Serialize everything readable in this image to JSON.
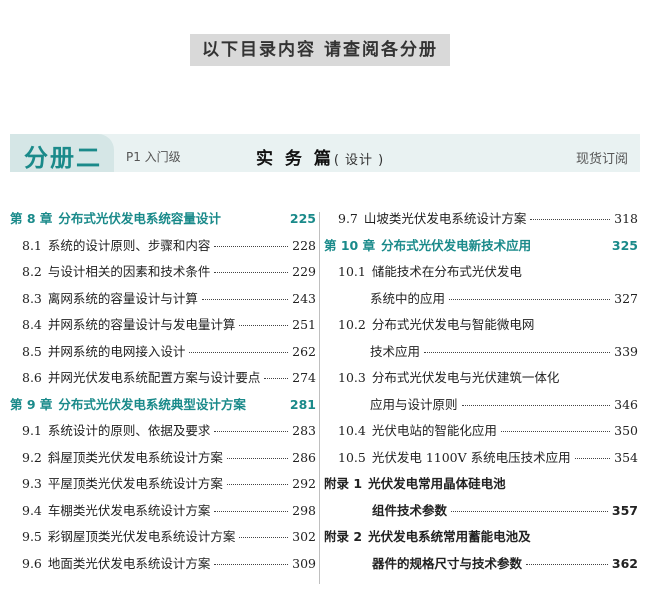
{
  "banner": "以下目录内容 请查阅各分册",
  "header": {
    "volume": "分册二",
    "level": "P1 入门级",
    "title": "实 务 篇",
    "title_sub": "( 设计 )",
    "stock": "现货订阅"
  },
  "left": [
    {
      "type": "ch",
      "num": "第 8 章",
      "text": "分布式光伏发电系统容量设计",
      "page": "225"
    },
    {
      "type": "sec",
      "num": "8.1",
      "text": "系统的设计原则、步骤和内容",
      "page": "228"
    },
    {
      "type": "sec",
      "num": "8.2",
      "text": "与设计相关的因素和技术条件",
      "page": "229"
    },
    {
      "type": "sec",
      "num": "8.3",
      "text": "离网系统的容量设计与计算",
      "page": "243"
    },
    {
      "type": "sec",
      "num": "8.4",
      "text": "并网系统的容量设计与发电量计算",
      "page": "251"
    },
    {
      "type": "sec",
      "num": "8.5",
      "text": "并网系统的电网接入设计",
      "page": "262"
    },
    {
      "type": "sec",
      "num": "8.6",
      "text": "并网光伏发电系统配置方案与设计要点",
      "page": "274"
    },
    {
      "type": "ch",
      "num": "第 9 章",
      "text": "分布式光伏发电系统典型设计方案",
      "page": "281"
    },
    {
      "type": "sec",
      "num": "9.1",
      "text": "系统设计的原则、依据及要求",
      "page": "283"
    },
    {
      "type": "sec",
      "num": "9.2",
      "text": "斜屋顶类光伏发电系统设计方案",
      "page": "286"
    },
    {
      "type": "sec",
      "num": "9.3",
      "text": "平屋顶类光伏发电系统设计方案",
      "page": "292"
    },
    {
      "type": "sec",
      "num": "9.4",
      "text": "车棚类光伏发电系统设计方案",
      "page": "298"
    },
    {
      "type": "sec",
      "num": "9.5",
      "text": "彩钢屋顶类光伏发电系统设计方案",
      "page": "302"
    },
    {
      "type": "sec",
      "num": "9.6",
      "text": "地面类光伏发电系统设计方案",
      "page": "309"
    }
  ],
  "right": [
    {
      "type": "sec2",
      "num": "9.7",
      "text": "山坡类光伏发电系统设计方案",
      "page": "318"
    },
    {
      "type": "ch",
      "num": "第 10 章",
      "text": "分布式光伏发电新技术应用",
      "page": "325"
    },
    {
      "type": "sec2",
      "num": "10.1",
      "text": "储能技术在分布式光伏发电",
      "page": ""
    },
    {
      "type": "cont",
      "num": "",
      "text": "系统中的应用",
      "page": "327"
    },
    {
      "type": "sec2",
      "num": "10.2",
      "text": "分布式光伏发电与智能微电网",
      "page": ""
    },
    {
      "type": "cont",
      "num": "",
      "text": "技术应用",
      "page": "339"
    },
    {
      "type": "sec2",
      "num": "10.3",
      "text": "分布式光伏发电与光伏建筑一体化",
      "page": ""
    },
    {
      "type": "cont",
      "num": "",
      "text": "应用与设计原则",
      "page": "346"
    },
    {
      "type": "sec2",
      "num": "10.4",
      "text": "光伏电站的智能化应用",
      "page": "350"
    },
    {
      "type": "sec2",
      "num": "10.5",
      "text": "光伏发电 1100V 系统电压技术应用",
      "page": "354"
    },
    {
      "type": "app",
      "num": "附录 1",
      "text": "光伏发电常用晶体硅电池",
      "page": ""
    },
    {
      "type": "appc",
      "num": "",
      "text": "组件技术参数",
      "page": "357"
    },
    {
      "type": "app",
      "num": "附录 2",
      "text": "光伏发电系统常用蓄能电池及",
      "page": ""
    },
    {
      "type": "appc",
      "num": "",
      "text": "器件的规格尺寸与技术参数",
      "page": "362"
    }
  ]
}
